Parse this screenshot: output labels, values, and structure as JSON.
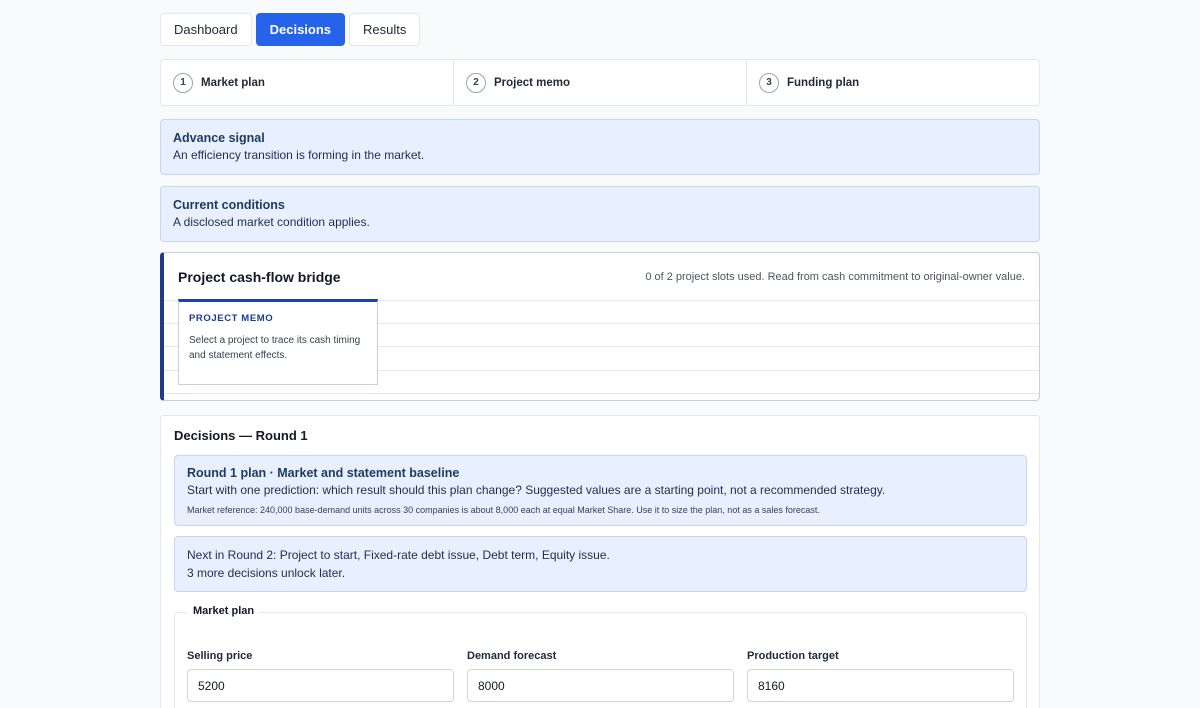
{
  "tabs": [
    {
      "label": "Dashboard",
      "active": false
    },
    {
      "label": "Decisions",
      "active": true
    },
    {
      "label": "Results",
      "active": false
    }
  ],
  "steps": [
    {
      "num": "1",
      "label": "Market plan"
    },
    {
      "num": "2",
      "label": "Project memo"
    },
    {
      "num": "3",
      "label": "Funding plan"
    }
  ],
  "advance_signal": {
    "title": "Advance signal",
    "text": "An efficiency transition is forming in the market."
  },
  "current_conditions": {
    "title": "Current conditions",
    "text": "A disclosed market condition applies."
  },
  "bridge": {
    "title": "Project cash-flow bridge",
    "status": "0 of 2 project slots used. Read from cash commitment to original-owner value.",
    "memo_label": "PROJECT MEMO",
    "memo_text": "Select a project to trace its cash timing and statement effects."
  },
  "decisions": {
    "title": "Decisions — Round 1",
    "plan_title": "Round 1 plan · Market and statement baseline",
    "plan_text": "Start with one prediction: which result should this plan change? Suggested values are a starting point, not a recommended strategy.",
    "plan_small": "Market reference: 240,000 base-demand units across 30 companies is about 8,000 each at equal Market Share. Use it to size the plan, not as a sales forecast.",
    "next_line1": "Next in Round 2: Project to start, Fixed-rate debt issue, Debt term, Equity issue.",
    "next_line2": "3 more decisions unlock later.",
    "fieldset_legend": "Market plan",
    "fields": [
      {
        "label": "Selling price",
        "value": "5200"
      },
      {
        "label": "Demand forecast",
        "value": "8000"
      },
      {
        "label": "Production target",
        "value": "8160"
      }
    ]
  },
  "colors": {
    "accent": "#2563eb",
    "notice_bg": "#e8efff",
    "bridge_accent": "#1e3a8a"
  }
}
